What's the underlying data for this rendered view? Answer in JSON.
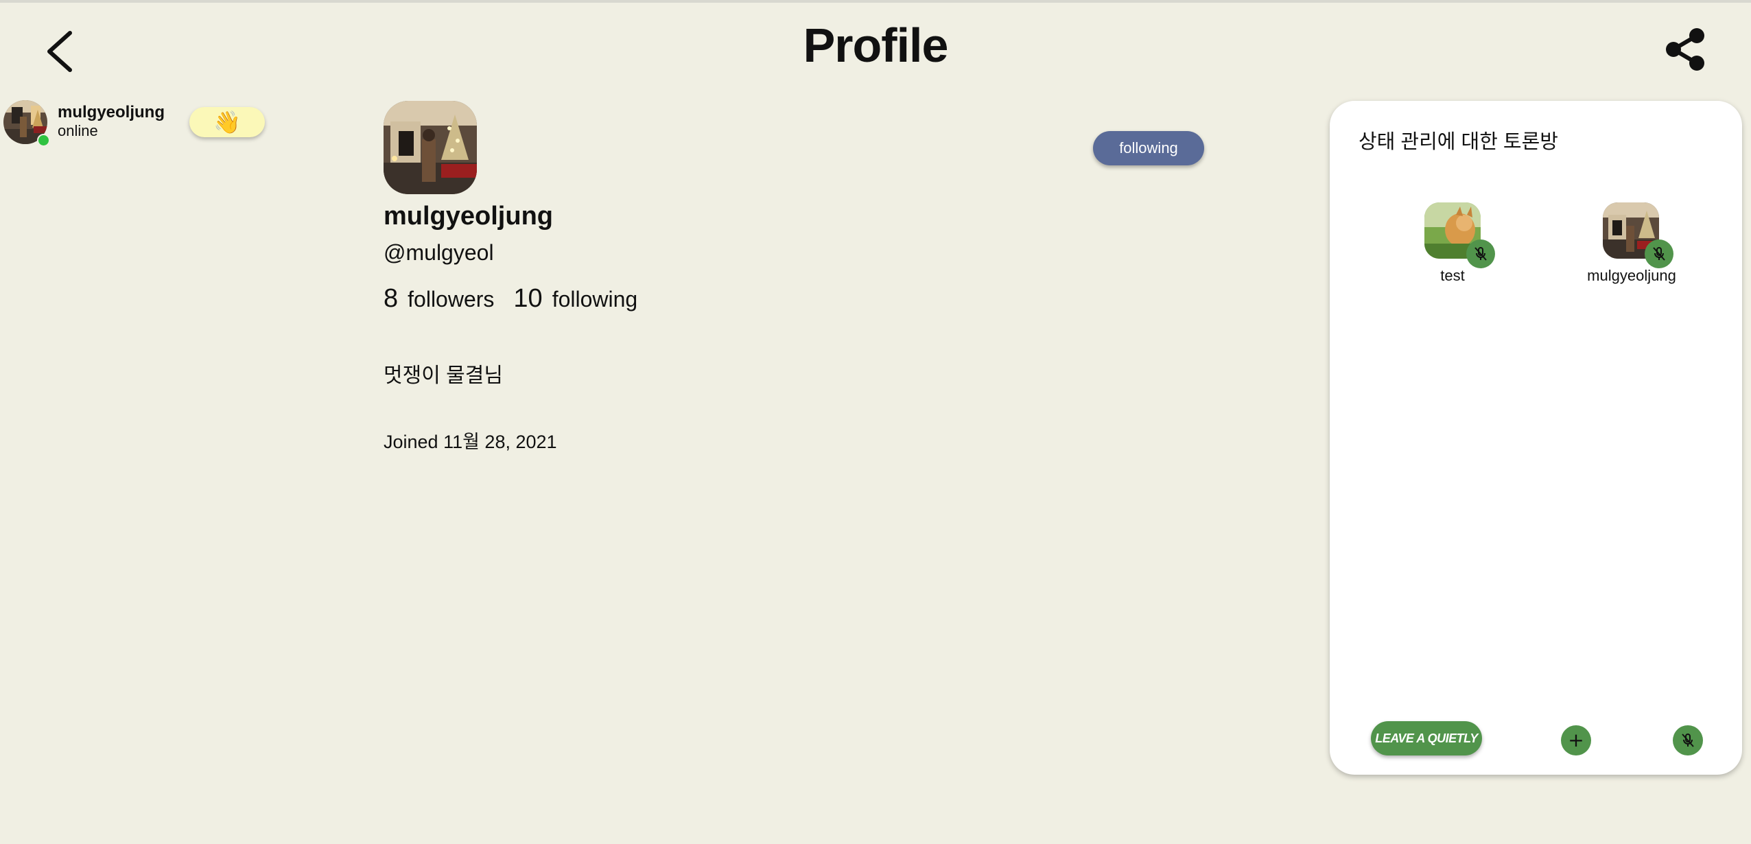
{
  "header": {
    "title": "Profile",
    "back_icon": "chevron-left-icon",
    "share_icon": "share-icon"
  },
  "online_user": {
    "name": "mulgyeoljung",
    "status": "online",
    "wave_emoji": "👋"
  },
  "profile": {
    "name": "mulgyeoljung",
    "handle": "@mulgyeol",
    "followers_count": "8",
    "followers_label": "followers",
    "following_count": "10",
    "following_label": "following",
    "follow_button": "following",
    "bio": "멋쟁이 물결님",
    "joined": "Joined 11월 28, 2021"
  },
  "room": {
    "title": "상태 관리에 대한 토론방",
    "speakers": [
      {
        "name": "test",
        "muted": true
      },
      {
        "name": "mulgyeoljung",
        "muted": true
      }
    ],
    "leave_label": "LEAVE A QUIETLY",
    "add_icon": "plus-icon",
    "mic_icon": "mic-off-icon"
  },
  "colors": {
    "background": "#f0efe3",
    "follow_button": "#5a6b98",
    "room_green": "#51944b",
    "online_dot": "#2fc240",
    "wave_bg": "#fbf8b8"
  }
}
